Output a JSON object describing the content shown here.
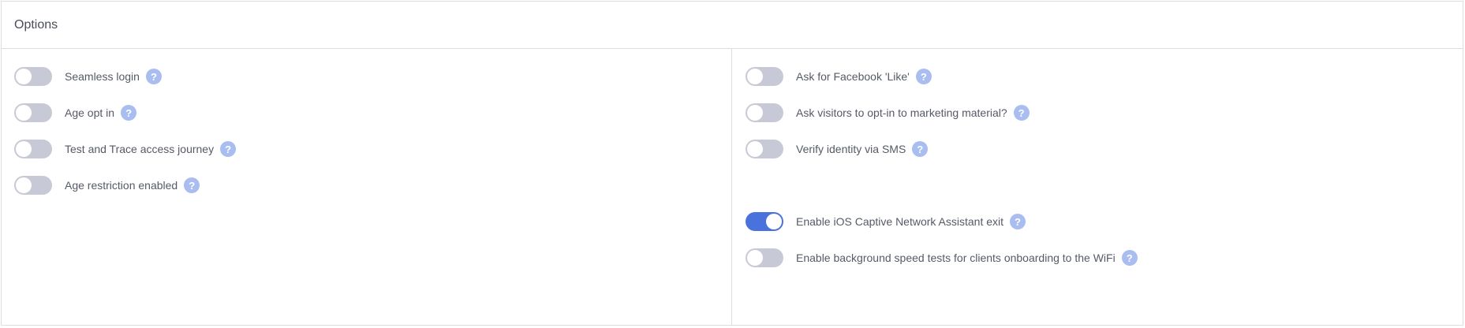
{
  "panel": {
    "title": "Options"
  },
  "help_icon_glyph": "?",
  "colors": {
    "toggle_on": "#4a72dc",
    "toggle_off": "#c8c9d6",
    "help_icon": "#a9bdf0"
  },
  "left_options": [
    {
      "label": "Seamless login",
      "enabled": false
    },
    {
      "label": "Age opt in",
      "enabled": false
    },
    {
      "label": "Test and Trace access journey",
      "enabled": false
    },
    {
      "label": "Age restriction enabled",
      "enabled": false
    }
  ],
  "right_options": [
    {
      "label": "Ask for Facebook 'Like'",
      "enabled": false
    },
    {
      "label": "Ask visitors to opt-in to marketing material?",
      "enabled": false
    },
    {
      "label": "Verify identity via SMS",
      "enabled": false
    },
    {
      "label": "Enable iOS Captive Network Assistant exit",
      "enabled": true
    },
    {
      "label": "Enable background speed tests for clients onboarding to the WiFi",
      "enabled": false
    }
  ]
}
